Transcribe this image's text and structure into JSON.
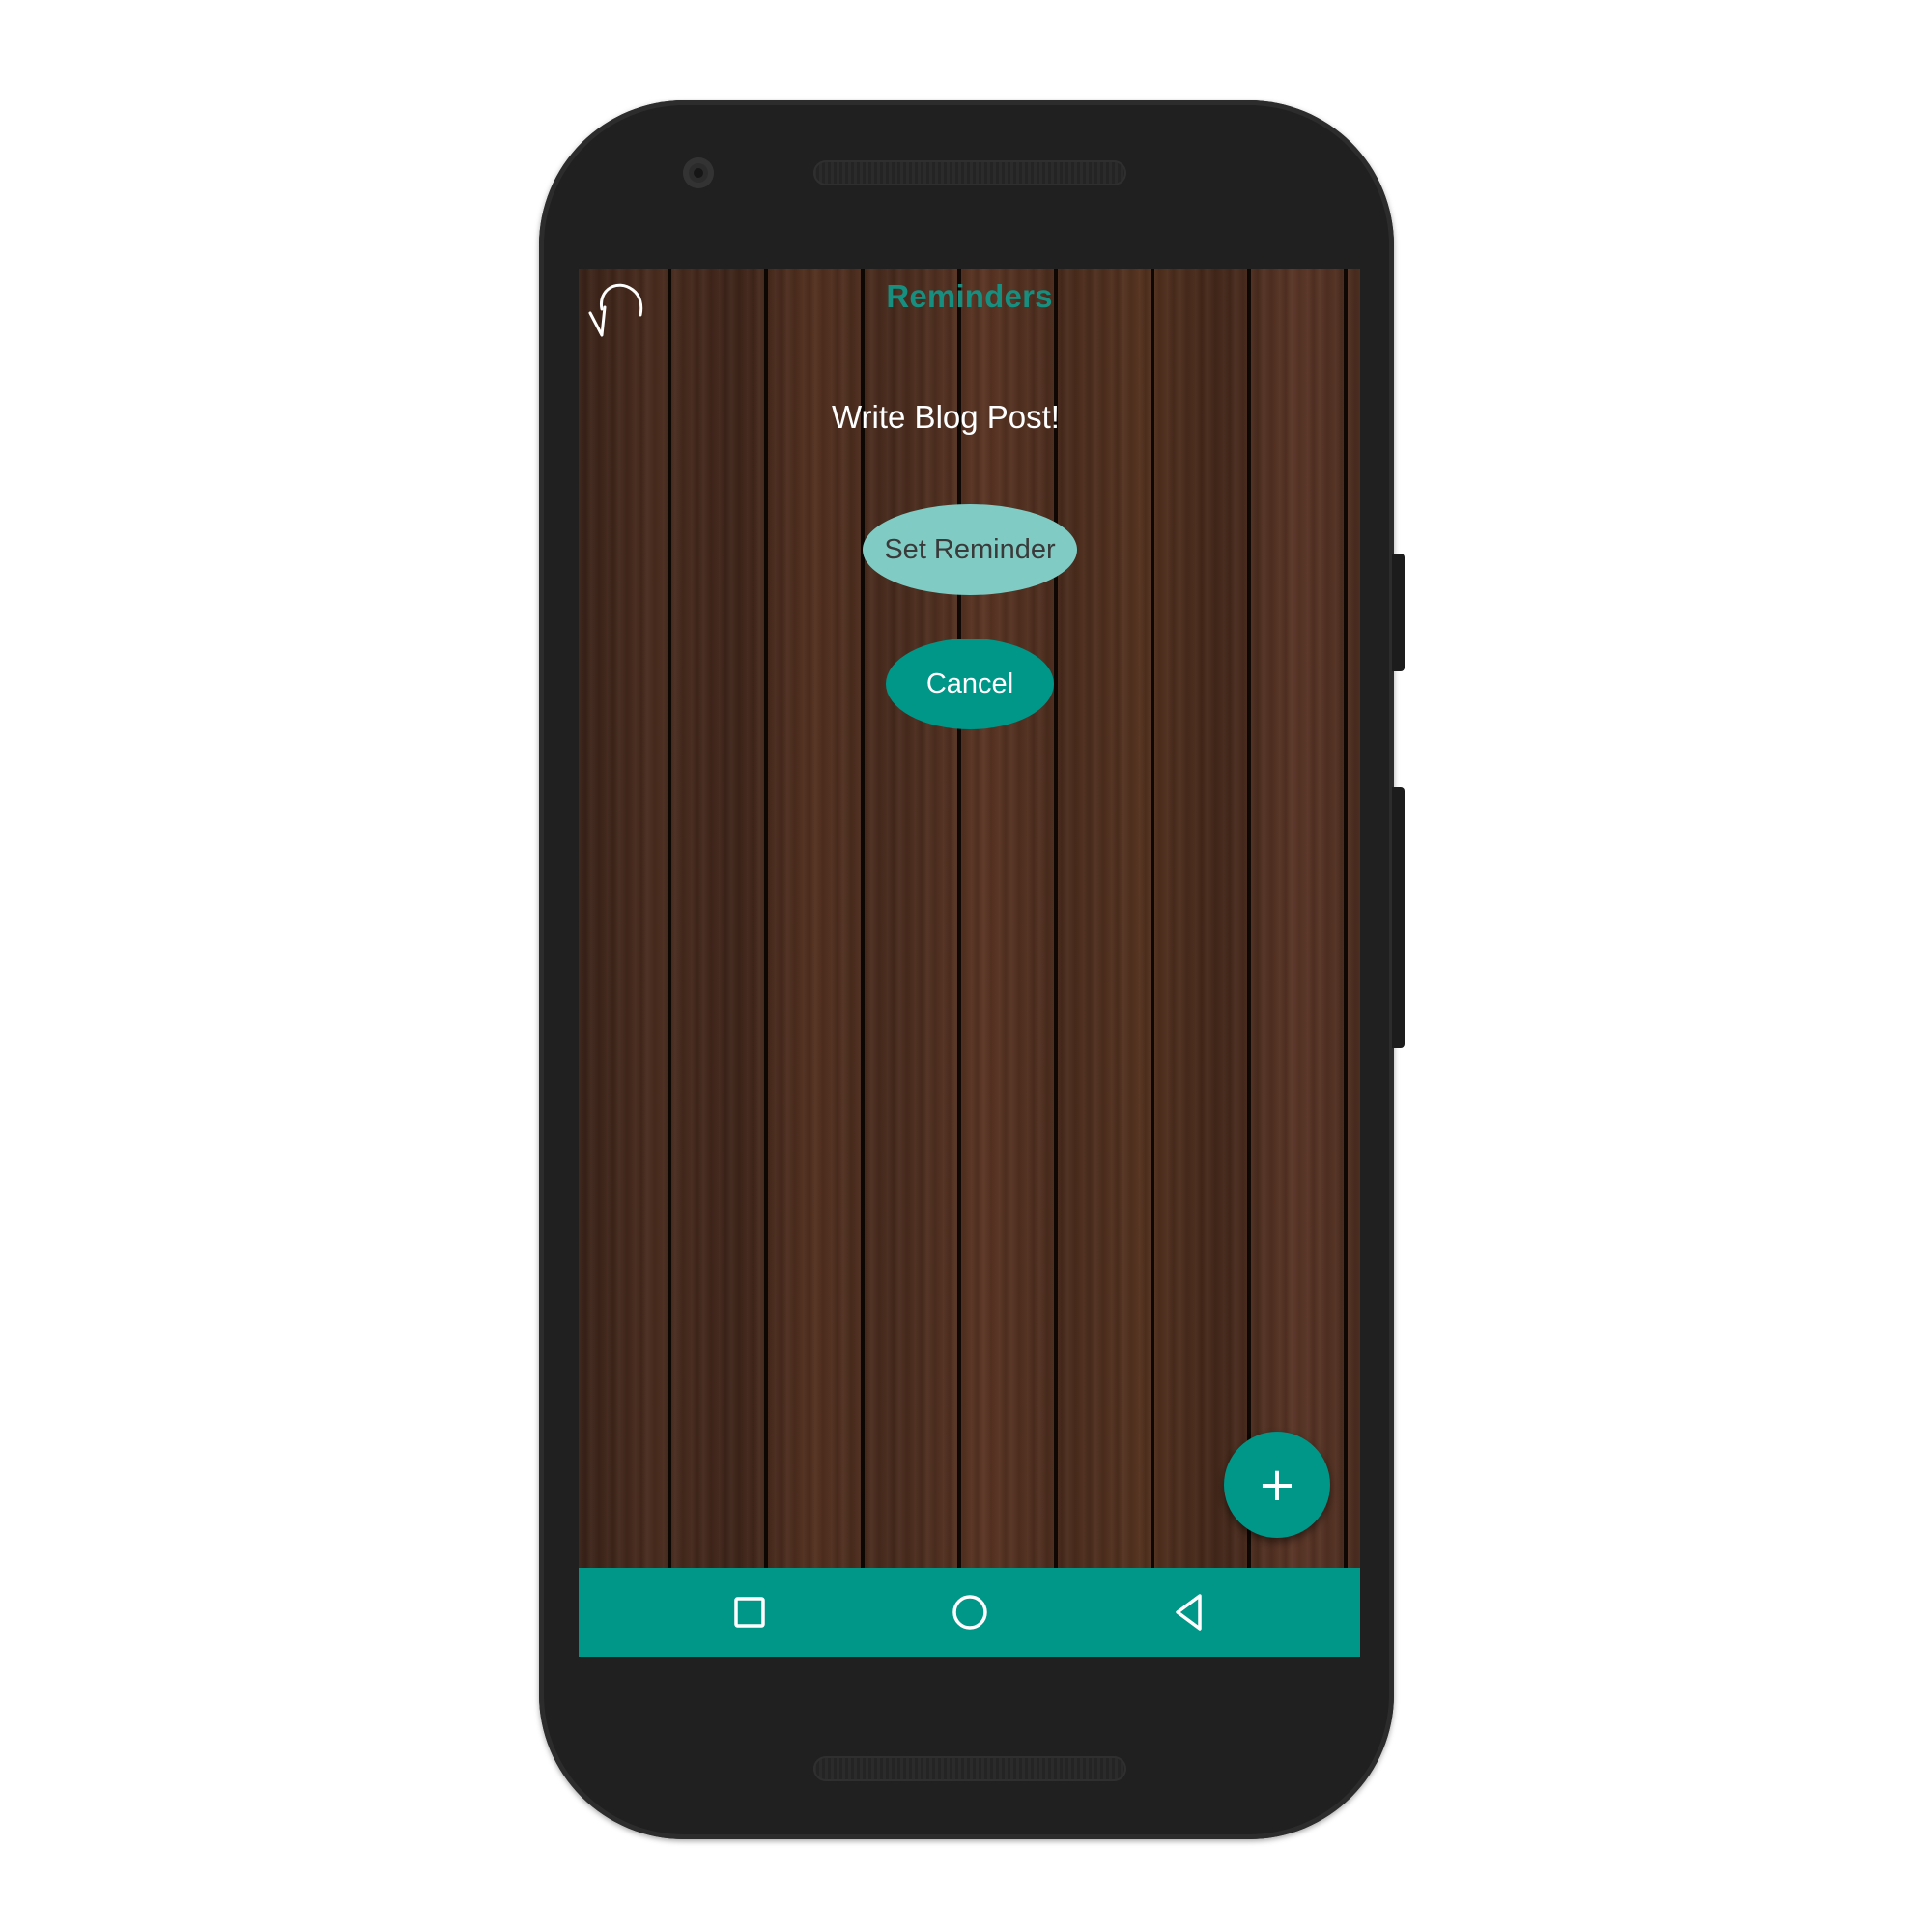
{
  "app": {
    "title": "Reminders"
  },
  "reminder": {
    "text": "Write Blog Post!"
  },
  "buttons": {
    "set_reminder": "Set Reminder",
    "cancel": "Cancel",
    "fab": "+"
  },
  "icons": {
    "back": "undo-arrow-icon",
    "fab": "plus-icon",
    "nav_recents": "square-icon",
    "nav_home": "circle-icon",
    "nav_back": "triangle-back-icon"
  },
  "colors": {
    "accent": "#009688",
    "accent_light": "#80cbc4",
    "title": "#168f80",
    "text": "#ffffff",
    "phone_body": "#202020"
  }
}
